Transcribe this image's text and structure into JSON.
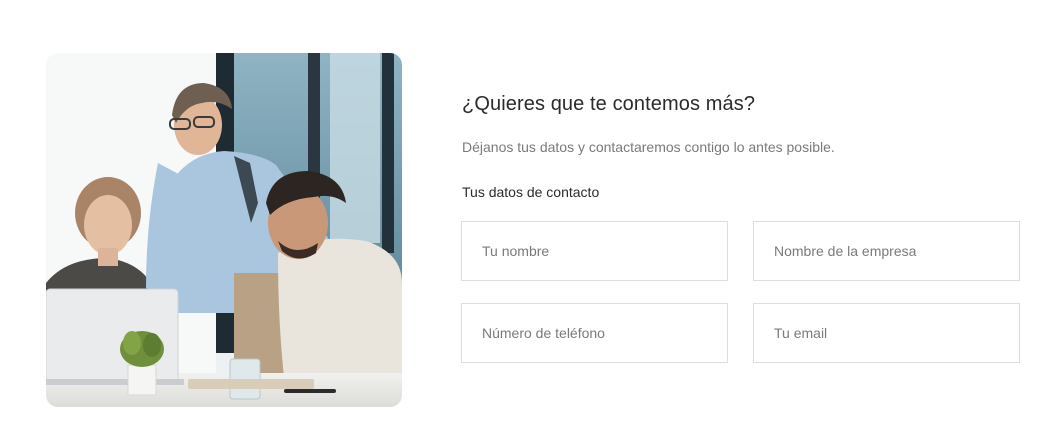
{
  "contact_section": {
    "heading": "¿Quieres que te contemos más?",
    "subtitle": "Déjanos tus datos y contactaremos contigo lo antes posible.",
    "section_label": "Tus datos de contacto",
    "fields": {
      "name": {
        "value": "",
        "placeholder": "Tu nombre"
      },
      "company": {
        "value": "",
        "placeholder": "Nombre de la empresa"
      },
      "phone": {
        "value": "",
        "placeholder": "Número de teléfono"
      },
      "email": {
        "value": "",
        "placeholder": "Tu email"
      }
    }
  },
  "colors": {
    "heading": "#2b2b2b",
    "muted_text": "#7a7a7a",
    "field_border": "#dedede",
    "background": "#ffffff"
  }
}
